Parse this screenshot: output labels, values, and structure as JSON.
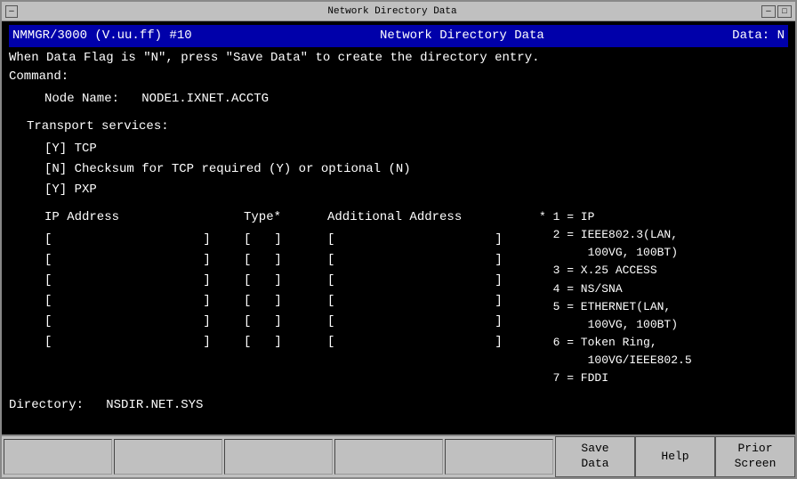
{
  "window": {
    "title": "Network Directory Data",
    "controls": {
      "minimize": "─",
      "maximize": "□",
      "close": "×"
    }
  },
  "header": {
    "app_id": "NMMGR/3000 (V.uu.ff) #10",
    "title": "Network Directory Data",
    "data_flag_label": "Data: N",
    "info_line": "When Data Flag is \"N\", press \"Save Data\" to create the directory entry.",
    "command_label": "Command:"
  },
  "form": {
    "node_label": "Node Name:",
    "node_value": "NODE1.IXNET.ACCTG",
    "transport_label": "Transport services:",
    "transport_items": [
      {
        "flag": "Y",
        "description": "TCP"
      },
      {
        "flag": "N",
        "description": "Checksum for TCP required (Y) or optional (N)"
      },
      {
        "flag": "Y",
        "description": "PXP"
      }
    ],
    "columns": {
      "ip_address": "IP Address",
      "type": "Type*",
      "additional_address": "Additional Address"
    },
    "ip_rows": 6,
    "type_rows": 6,
    "add_rows": 6,
    "legend": [
      "* 1 = IP",
      "  2 = IEEE802.3(LAN,",
      "       100VG, 100BT)",
      "  3 = X.25 ACCESS",
      "  4 = NS/SNA",
      "  5 = ETHERNET(LAN,",
      "       100VG, 100BT)",
      "  6 = Token Ring,",
      "       100VG/IEEE802.5",
      "  7 = FDDI"
    ],
    "directory_label": "Directory:",
    "directory_value": "NSDIR.NET.SYS"
  },
  "toolbar": {
    "buttons": [
      {
        "id": "save-data",
        "label": "Save\nData"
      },
      {
        "id": "help",
        "label": "Help"
      },
      {
        "id": "prior-screen",
        "label": "Prior\nScreen"
      }
    ],
    "input_count": 5
  }
}
